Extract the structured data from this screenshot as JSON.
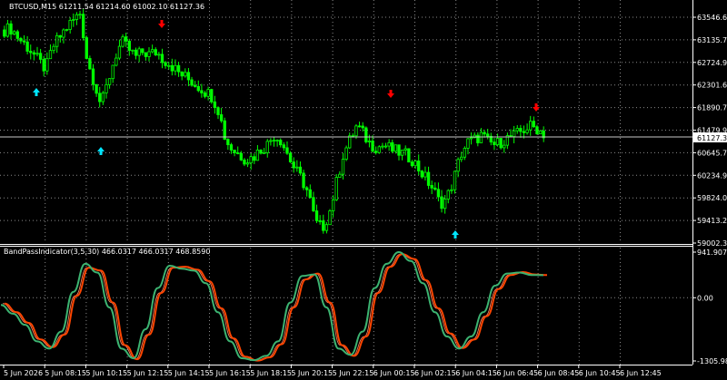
{
  "main_chart": {
    "title": "BTCUSD,M15  61211.54 61214.60 61002.10 61127.36",
    "current_price_label": "61127.36",
    "price_axis_labels": [
      "63546.60",
      "63135.75",
      "62724.90",
      "62301.60",
      "61890.75",
      "61479.90",
      "61127.36",
      "60645.75",
      "60234.90",
      "59824.05",
      "59413.20",
      "59002.35"
    ],
    "colors": {
      "background": "#000000",
      "candle": "#00ff00",
      "grid": "#8a8a8a",
      "buy_arrow": "#00e5ff",
      "sell_arrow": "#ff0000",
      "price_line": "#c8c8c8"
    },
    "buy_arrow_icon": "arrow-up-icon",
    "sell_arrow_icon": "arrow-down-icon"
  },
  "indicator": {
    "title": "BandPassIndicator(3,5,30) 466.0317 466.0317 468.8590",
    "axis_labels": [
      "941.9076",
      "0.00",
      "-1305.9845"
    ],
    "colors": {
      "fast": "#3cb371",
      "slow": "#ff4500",
      "thin": "#ff8c69"
    }
  },
  "time_axis": {
    "labels": [
      "5 Jun 2026",
      "5 Jun 08:15",
      "5 Jun 10:15",
      "5 Jun 12:15",
      "5 Jun 14:15",
      "5 Jun 16:15",
      "5 Jun 18:15",
      "5 Jun 20:15",
      "5 Jun 22:15",
      "6 Jun 00:15",
      "6 Jun 02:15",
      "6 Jun 04:15",
      "6 Jun 06:45",
      "6 Jun 08:45",
      "6 Jun 10:45",
      "6 Jun 12:45"
    ]
  },
  "chart_data": [
    {
      "type": "candlestick",
      "title": "BTCUSD,M15  61211.54 61214.60 61002.10 61127.36",
      "ylim": [
        59002.35,
        63750
      ],
      "x": [
        "5 Jun 2026",
        "5 Jun 08:15",
        "5 Jun 10:15",
        "5 Jun 12:15",
        "5 Jun 14:15",
        "5 Jun 16:15",
        "5 Jun 18:15",
        "5 Jun 20:15",
        "5 Jun 22:15",
        "6 Jun 00:15",
        "6 Jun 02:15",
        "6 Jun 04:15",
        "6 Jun 06:45",
        "6 Jun 08:45",
        "6 Jun 10:45",
        "6 Jun 12:45"
      ],
      "close_path": [
        63250,
        63280,
        63090,
        62950,
        62800,
        62600,
        62450,
        62900,
        63100,
        63300,
        63450,
        63600,
        62600,
        62200,
        61700,
        62200,
        62700,
        63000,
        62850,
        62700,
        62800,
        62750,
        62800,
        62650,
        62550,
        62400,
        62300,
        62200,
        62100,
        62000,
        61900,
        61600,
        61000,
        60800,
        60700,
        60600,
        60650,
        60800,
        60900,
        61100,
        61000,
        60700,
        60400,
        60200,
        59900,
        59300,
        59200,
        59500,
        60100,
        60700,
        61000,
        61300,
        61100,
        60900,
        60850,
        60900,
        60800,
        60750,
        60700,
        60600,
        60400,
        60200,
        60000,
        59700,
        59800,
        60200,
        60700,
        60950,
        61000,
        61100,
        60950,
        60900,
        60980,
        61050,
        61100,
        61200,
        61280,
        61240,
        61127
      ],
      "buy_signals": [
        "5 Jun 2026",
        "5 Jun 08:15",
        "6 Jun 08:45"
      ],
      "sell_signals": [
        "5 Jun 12:15",
        "6 Jun 02:15",
        "6 Jun 12:45"
      ],
      "current_price": 61127.36
    },
    {
      "type": "line",
      "title": "BandPassIndicator(3,5,30) 466.0317 466.0317 468.8590",
      "ylim": [
        -1305.9845,
        941.9076
      ],
      "series": [
        {
          "name": "BandPass",
          "values": [
            -150,
            -330,
            -560,
            -900,
            -1050,
            -700,
            120,
            700,
            520,
            -200,
            -1050,
            -1250,
            -650,
            200,
            660,
            600,
            560,
            300,
            -300,
            -900,
            -1250,
            -1290,
            -1200,
            -900,
            -100,
            450,
            480,
            -200,
            -1050,
            -1180,
            -700,
            200,
            700,
            941,
            760,
            300,
            -300,
            -800,
            -1050,
            -800,
            -300,
            250,
            500,
            520,
            470,
            466
          ]
        },
        {
          "name": "",
          "values": [
            -120,
            -300,
            -520,
            -860,
            -1020,
            -760,
            40,
            620,
            560,
            -100,
            -980,
            -1270,
            -760,
            100,
            620,
            640,
            580,
            340,
            -220,
            -840,
            -1220,
            -1300,
            -1230,
            -960,
            -200,
            380,
            500,
            -100,
            -980,
            -1200,
            -800,
            100,
            640,
            900,
            800,
            360,
            -220,
            -740,
            -1040,
            -860,
            -380,
            180,
            470,
            530,
            480,
            468
          ]
        }
      ]
    }
  ]
}
